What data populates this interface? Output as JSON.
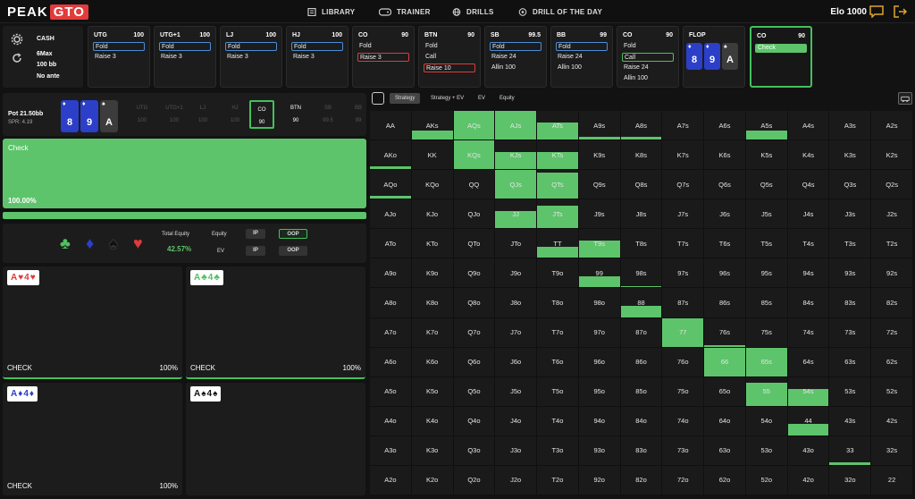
{
  "brand": {
    "left": "PEAK",
    "right": "GTO"
  },
  "nav": {
    "library": "LIBRARY",
    "trainer": "TRAINER",
    "drills": "DRILLS",
    "drill_of_day": "DRILL OF THE DAY"
  },
  "elo": "Elo 1000",
  "setup": {
    "game": "CASH",
    "table": "6Max",
    "stack": "100 bb",
    "ante": "No ante"
  },
  "positions": [
    {
      "name": "UTG",
      "stack": "100",
      "actions": [
        "Fold",
        "Raise 3"
      ],
      "selected": "Fold"
    },
    {
      "name": "UTG+1",
      "stack": "100",
      "actions": [
        "Fold",
        "Raise 3"
      ],
      "selected": "Fold"
    },
    {
      "name": "LJ",
      "stack": "100",
      "actions": [
        "Fold",
        "Raise 3"
      ],
      "selected": "Fold"
    },
    {
      "name": "HJ",
      "stack": "100",
      "actions": [
        "Fold",
        "Raise 3"
      ],
      "selected": "Fold"
    },
    {
      "name": "CO",
      "stack": "90",
      "actions": [
        "Fold",
        "Raise 3"
      ],
      "selected": "Raise 3"
    },
    {
      "name": "BTN",
      "stack": "90",
      "actions": [
        "Fold",
        "Call",
        "Raise 10"
      ],
      "selected": "Raise 10"
    },
    {
      "name": "SB",
      "stack": "99.5",
      "actions": [
        "Fold",
        "Raise 24",
        "Allin 100"
      ],
      "selected": "Fold"
    },
    {
      "name": "BB",
      "stack": "99",
      "actions": [
        "Fold",
        "Raise 24",
        "Allin 100"
      ],
      "selected": "Fold"
    },
    {
      "name": "CO",
      "stack": "90",
      "actions": [
        "Fold",
        "Call",
        "Raise 24",
        "Allin 100"
      ],
      "selected": "Call"
    }
  ],
  "flop": {
    "label": "FLOP",
    "cards": [
      {
        "rank": "8",
        "suit": "♦"
      },
      {
        "rank": "9",
        "suit": "♦"
      },
      {
        "rank": "A",
        "suit": "♠"
      }
    ]
  },
  "current": {
    "name": "CO",
    "stack": "90",
    "action": "Check"
  },
  "pot": {
    "label": "Pot  21.50bb",
    "spr": "SPR: 4.19"
  },
  "seats": [
    {
      "name": "UTG",
      "stack": "100"
    },
    {
      "name": "UTG+1",
      "stack": "100"
    },
    {
      "name": "LJ",
      "stack": "100"
    },
    {
      "name": "HJ",
      "stack": "100"
    },
    {
      "name": "CO",
      "stack": "90"
    },
    {
      "name": "BTN",
      "stack": "90"
    },
    {
      "name": "SB",
      "stack": "99.5"
    },
    {
      "name": "BB",
      "stack": "99"
    }
  ],
  "strategy": {
    "label": "Check",
    "pct": "100.00%"
  },
  "equity": {
    "total_label": "Total Equity",
    "total_value": "42.57%",
    "equity_label": "Equity",
    "ev_label": "EV",
    "ip": "IP",
    "oop": "OOP"
  },
  "suits": [
    "♣",
    "♦",
    "♠",
    "♥"
  ],
  "hands": [
    {
      "r1": "A",
      "s1": "♥",
      "r2": "4",
      "s2": "♥",
      "color": "red",
      "action": "CHECK",
      "pct": "100%"
    },
    {
      "r1": "A",
      "s1": "♣",
      "r2": "4",
      "s2": "♣",
      "color": "green",
      "action": "CHECK",
      "pct": "100%"
    },
    {
      "r1": "A",
      "s1": "♦",
      "r2": "4",
      "s2": "♦",
      "color": "blue",
      "action": "CHECK",
      "pct": "100%"
    },
    {
      "r1": "A",
      "s1": "♠",
      "r2": "4",
      "s2": "♠",
      "color": "black",
      "action": "",
      "pct": ""
    }
  ],
  "tabs": {
    "strategy": "Strategy",
    "strategy_ev": "Strategy + EV",
    "ev": "EV",
    "equity": "Equity"
  },
  "matrix": {
    "ranks": [
      "A",
      "K",
      "Q",
      "J",
      "T",
      "9",
      "8",
      "7",
      "6",
      "5",
      "4",
      "3",
      "2"
    ],
    "fills": [
      [
        0,
        0.3,
        1,
        1,
        0.6,
        0.1,
        0.1,
        0,
        0,
        0.3,
        0,
        0,
        0
      ],
      [
        0.1,
        0,
        1,
        0.6,
        0.6,
        0,
        0,
        0,
        0,
        0,
        0,
        0,
        0
      ],
      [
        0.1,
        0,
        0,
        1,
        0.9,
        0,
        0,
        0,
        0,
        0,
        0,
        0,
        0
      ],
      [
        0,
        0,
        0,
        0.6,
        0.8,
        0,
        0,
        0,
        0,
        0,
        0,
        0,
        0
      ],
      [
        0,
        0,
        0,
        0,
        0.4,
        0.6,
        0,
        0,
        0,
        0,
        0,
        0,
        0
      ],
      [
        0,
        0,
        0,
        0,
        0,
        0.4,
        0.05,
        0,
        0,
        0,
        0,
        0,
        0
      ],
      [
        0,
        0,
        0,
        0,
        0,
        0,
        0.4,
        0,
        0,
        0,
        0,
        0,
        0
      ],
      [
        0,
        0,
        0,
        0,
        0,
        0,
        0,
        1,
        0.05,
        0,
        0,
        0,
        0
      ],
      [
        0,
        0,
        0,
        0,
        0,
        0,
        0,
        0,
        1,
        1,
        0,
        0,
        0
      ],
      [
        0,
        0,
        0,
        0,
        0,
        0,
        0,
        0,
        0,
        0.8,
        0.6,
        0,
        0
      ],
      [
        0,
        0,
        0,
        0,
        0,
        0,
        0,
        0,
        0,
        0,
        0.4,
        0,
        0
      ],
      [
        0,
        0,
        0,
        0,
        0,
        0,
        0,
        0,
        0,
        0,
        0,
        0.1,
        0
      ],
      [
        0,
        0,
        0,
        0,
        0,
        0,
        0,
        0,
        0,
        0,
        0,
        0,
        0
      ]
    ]
  },
  "colors": {
    "green": "#5dc46b",
    "blue": "#2c3fc9",
    "red": "#e03a3a",
    "bg": "#121212"
  }
}
